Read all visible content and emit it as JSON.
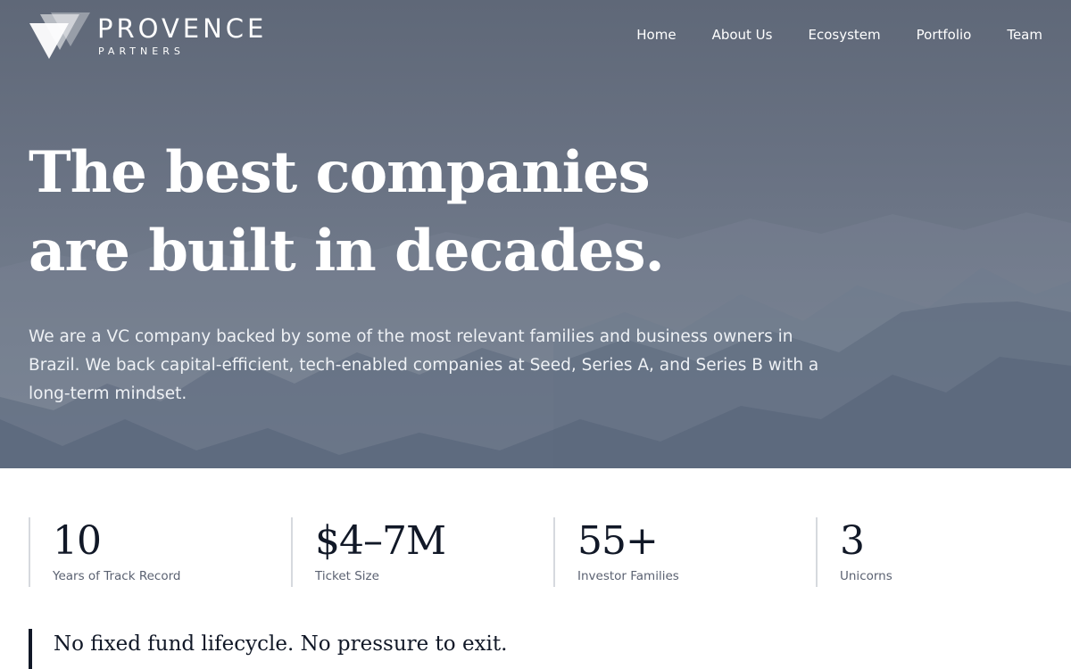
{
  "brand": {
    "name": "PROVENCE",
    "tagline": "PARTNERS",
    "logo_icon": "triangles-logo-icon"
  },
  "nav": {
    "items": [
      {
        "label": "Home"
      },
      {
        "label": "About Us"
      },
      {
        "label": "Ecosystem"
      },
      {
        "label": "Portfolio"
      },
      {
        "label": "Team"
      }
    ]
  },
  "hero": {
    "headline_line1": "The best companies",
    "headline_line2": "are built in decades.",
    "description": "We are a VC company backed by some of the most relevant families and business owners in Brazil. We back capital-efficient, tech-enabled companies at Seed, Series A, and Series B with a long-term mindset."
  },
  "stats": [
    {
      "value": "10",
      "label": "Years of Track Record"
    },
    {
      "value": "$4–7M",
      "label": "Ticket Size"
    },
    {
      "value": "55+",
      "label": "Investor Families"
    },
    {
      "value": "3",
      "label": "Unicorns"
    }
  ],
  "quote": {
    "text": "No fixed fund lifecycle. No pressure to exit."
  },
  "colors": {
    "hero_bg": "#66707f",
    "text_dark": "#111827",
    "divider": "#d6d9de"
  }
}
